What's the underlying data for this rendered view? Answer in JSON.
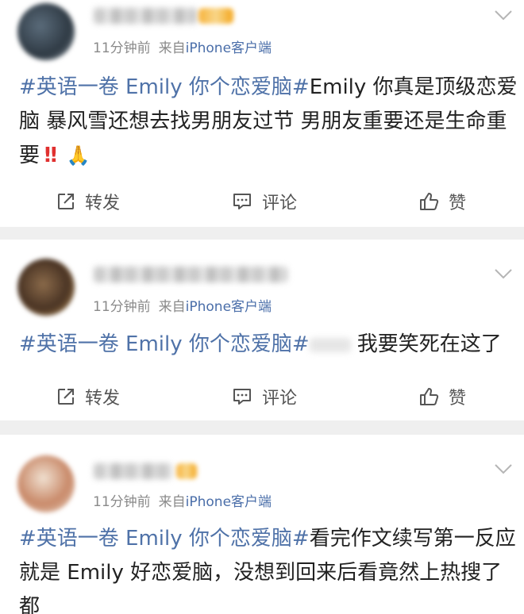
{
  "posts": [
    {
      "time": "11分钟前",
      "source_prefix": "来自",
      "device": "iPhone",
      "client": "客户端",
      "hashtag": "#英语一卷 Emily 你个恋爱脑#",
      "lines": [
        "Emily 你真是顶级恋爱",
        "脑 暴风雪还想去找男朋友过节 男朋友重要还是生命重",
        "要"
      ],
      "emphasis": "!!",
      "emoji": "🙏",
      "actions": {
        "repost": "转发",
        "comment": "评论",
        "like": "赞"
      }
    },
    {
      "time": "11分钟前",
      "source_prefix": "来自",
      "device": "iPhone",
      "client": "客户端",
      "hashtag": "#英语一卷 Emily 你个恋爱脑#",
      "lines": [
        "我要笑死在这了"
      ],
      "actions": {
        "repost": "转发",
        "comment": "评论",
        "like": "赞"
      }
    },
    {
      "time": "11分钟前",
      "source_prefix": "来自",
      "device": "iPhone",
      "client": "客户端",
      "hashtag": "#英语一卷 Emily 你个恋爱脑#",
      "lines": [
        "看完作文续写第一反应",
        "就是 Emily 好恋爱脑，没想到回来后看竟然上热搜了",
        "都"
      ]
    }
  ],
  "colors": {
    "link": "#4f72a8",
    "meta": "#8a8a8a",
    "emphasis": "#e0302f",
    "separator": "#efefef"
  },
  "icons": [
    "chevron-down-icon",
    "repost-icon",
    "comment-icon",
    "like-icon"
  ]
}
